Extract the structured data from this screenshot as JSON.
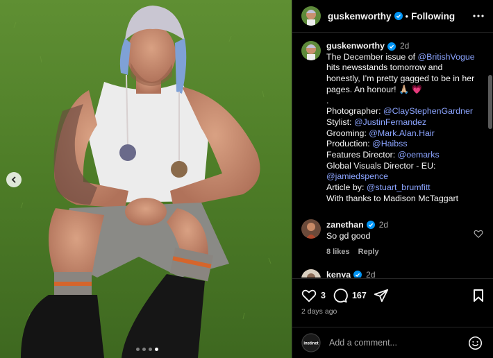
{
  "post": {
    "username": "guskenworthy",
    "following_label": "Following",
    "separator": "•",
    "caption_time": "2d",
    "caption": {
      "line1": "The December issue of ",
      "mention_vogue": "@BritishVogue",
      "line2": "hits newsstands tomorrow and",
      "line3": "honestly, I’m pretty gagged to be in her",
      "line4": "pages. An honour! 🙏🏼 💗",
      "dot": ".",
      "photographer_label": "Photographer: ",
      "photographer": "@ClayStephenGardner",
      "stylist_label": "Stylist: ",
      "stylist": "@JustinFernandez",
      "grooming_label": "Grooming: ",
      "grooming": "@Mark.Alan.Hair",
      "production_label": "Production: ",
      "production": "@Haibss",
      "features_label": "Features Director: ",
      "features": "@oemarks",
      "visuals_label": "Global Visuals Director - EU:",
      "visuals": "@jamiedspence",
      "article_label": "Article by: ",
      "article": "@stuart_brumfitt",
      "thanks": "With thanks to Madison McTaggart"
    }
  },
  "comments": [
    {
      "username": "zanethan",
      "time": "2d",
      "text": "So gd good",
      "likes": "8 likes",
      "reply": "Reply"
    },
    {
      "username": "kenya",
      "time": "2d"
    }
  ],
  "actions": {
    "likes": "3",
    "comments": "167",
    "posted": "2 days ago"
  },
  "add_comment": {
    "placeholder": "Add a comment...",
    "avatar_text": "instinct"
  },
  "colors": {
    "link": "#8ba4ff",
    "verified": "#0095f6",
    "like_heart": "#ffffff"
  }
}
